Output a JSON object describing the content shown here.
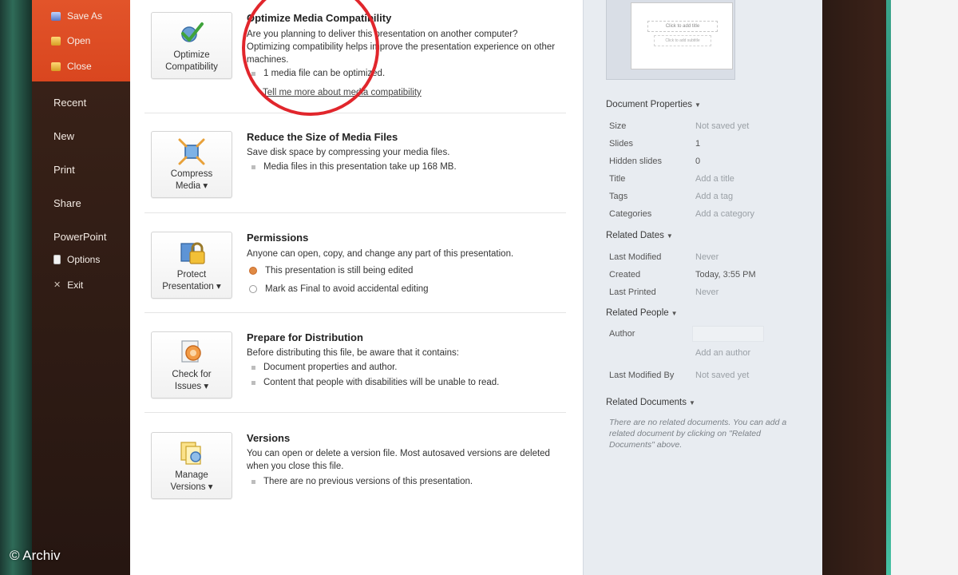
{
  "nav": {
    "top_items": [
      {
        "label": "Save As",
        "icon": "save-icon"
      },
      {
        "label": "Open",
        "icon": "folder-icon"
      },
      {
        "label": "Close",
        "icon": "folder-icon"
      }
    ],
    "main_items": [
      "Recent",
      "New",
      "Print",
      "Share",
      "PowerPoint"
    ],
    "options_label": "Options",
    "exit_label": "Exit"
  },
  "sections": [
    {
      "button_label": "Optimize Compatibility",
      "title": "Optimize Media Compatibility",
      "desc": "Are you planning to deliver this presentation on another computer? Optimizing compatibility helps improve the presentation experience on other machines.",
      "bullet": "1 media file can be optimized.",
      "link": "Tell me more about media compatibility"
    },
    {
      "button_label": "Compress Media ▾",
      "title": "Reduce the Size of Media Files",
      "desc": "Save disk space by compressing your media files.",
      "bullet": "Media files in this presentation take up 168 MB."
    },
    {
      "button_label": "Protect Presentation ▾",
      "title": "Permissions",
      "desc": "Anyone can open, copy, and change any part of this presentation.",
      "radio_1": "This presentation is still being edited",
      "radio_2": "Mark as Final to avoid accidental editing"
    },
    {
      "button_label": "Check for Issues ▾",
      "title": "Prepare for Distribution",
      "desc": "Before distributing this file, be aware that it contains:",
      "bullet_1": "Document properties and author.",
      "bullet_2": "Content that people with disabilities will be unable to read."
    },
    {
      "button_label": "Manage Versions ▾",
      "title": "Versions",
      "desc": "You can open or delete a version file. Most autosaved versions are deleted when you close this file.",
      "bullet": "There are no previous versions of this presentation."
    }
  ],
  "thumbnail": {
    "title_placeholder": "Click to add title",
    "subtitle_placeholder": "Click to add subtitle"
  },
  "properties": {
    "doc_header": "Document Properties",
    "doc_rows": [
      {
        "label": "Size",
        "value": "Not saved yet"
      },
      {
        "label": "Slides",
        "value": "1"
      },
      {
        "label": "Hidden slides",
        "value": "0"
      },
      {
        "label": "Title",
        "value": "Add a title"
      },
      {
        "label": "Tags",
        "value": "Add a tag"
      },
      {
        "label": "Categories",
        "value": "Add a category"
      }
    ],
    "dates_header": "Related Dates",
    "date_rows": [
      {
        "label": "Last Modified",
        "value": "Never"
      },
      {
        "label": "Created",
        "value": "Today, 3:55 PM"
      },
      {
        "label": "Last Printed",
        "value": "Never"
      }
    ],
    "people_header": "Related People",
    "author_label": "Author",
    "add_author": "Add an author",
    "last_modified_by_label": "Last Modified By",
    "last_modified_by_value": "Not saved yet",
    "docs_header": "Related Documents",
    "docs_note": "There are no related documents. You can add a related document by clicking on \"Related Documents\" above."
  },
  "watermark": "© Archiv"
}
